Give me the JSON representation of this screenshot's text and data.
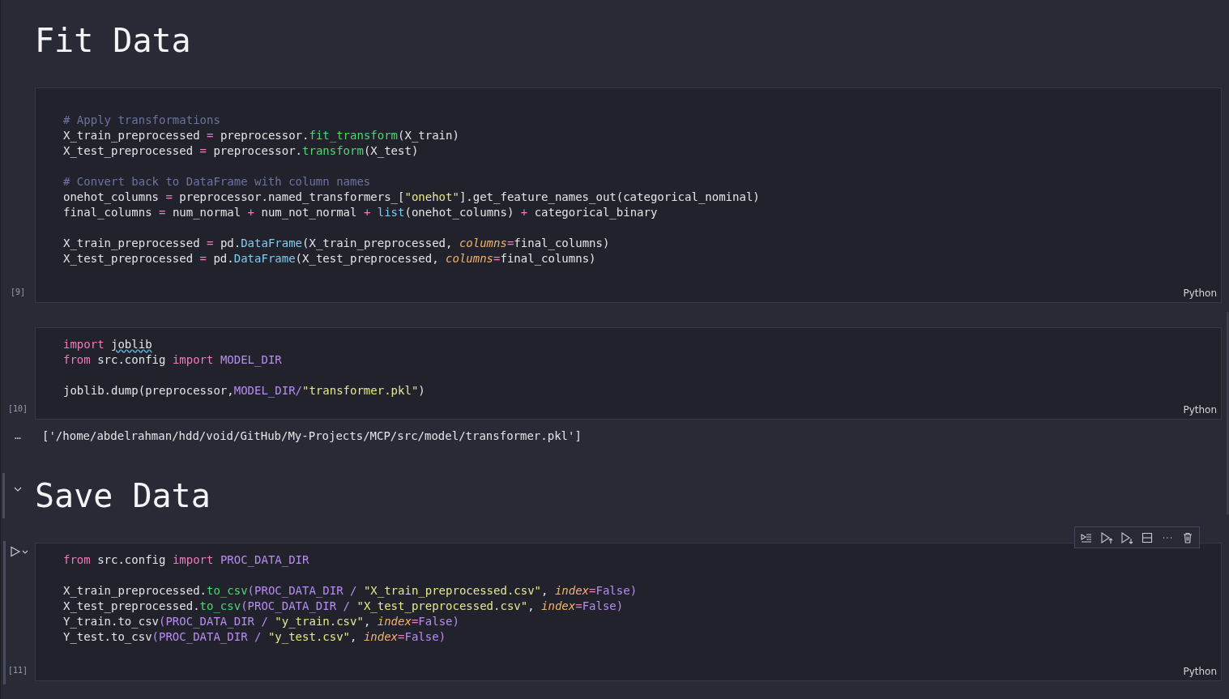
{
  "cells": [
    {
      "kind": "markdown",
      "text": "Fit Data",
      "selected": false
    },
    {
      "kind": "code",
      "count": "[9]",
      "language": "Python",
      "focused": false,
      "lines": [
        {
          "kind": "blank"
        },
        {
          "kind": "code",
          "tokens": [
            {
              "kind": "comment",
              "s": "# Apply transformations"
            }
          ]
        },
        {
          "kind": "code",
          "tokens": [
            {
              "kind": "plain",
              "s": "X_train_preprocessed "
            },
            {
              "kind": "op",
              "s": "="
            },
            {
              "kind": "plain",
              "s": " preprocessor."
            },
            {
              "kind": "func",
              "s": "fit_transform"
            },
            {
              "kind": "plain",
              "s": "(X_train)"
            }
          ]
        },
        {
          "kind": "code",
          "tokens": [
            {
              "kind": "plain",
              "s": "X_test_preprocessed "
            },
            {
              "kind": "op",
              "s": "="
            },
            {
              "kind": "plain",
              "s": " preprocessor."
            },
            {
              "kind": "func",
              "s": "transform"
            },
            {
              "kind": "plain",
              "s": "(X_test)"
            }
          ]
        },
        {
          "kind": "blank"
        },
        {
          "kind": "code",
          "tokens": [
            {
              "kind": "comment",
              "s": "# Convert back to DataFrame with column names"
            }
          ]
        },
        {
          "kind": "code",
          "tokens": [
            {
              "kind": "plain",
              "s": "onehot_columns "
            },
            {
              "kind": "op",
              "s": "="
            },
            {
              "kind": "plain",
              "s": " preprocessor.named_transformers_["
            },
            {
              "kind": "string",
              "s": "\"onehot\""
            },
            {
              "kind": "plain",
              "s": "].get_feature_names_out(categorical_nominal)"
            }
          ]
        },
        {
          "kind": "code",
          "tokens": [
            {
              "kind": "plain",
              "s": "final_columns "
            },
            {
              "kind": "op",
              "s": "="
            },
            {
              "kind": "plain",
              "s": " num_normal "
            },
            {
              "kind": "op",
              "s": "+"
            },
            {
              "kind": "plain",
              "s": " num_not_normal "
            },
            {
              "kind": "op",
              "s": "+ "
            },
            {
              "kind": "builtin",
              "s": "list"
            },
            {
              "kind": "plain",
              "s": "(onehot_columns) "
            },
            {
              "kind": "op",
              "s": "+"
            },
            {
              "kind": "plain",
              "s": " categorical_binary"
            }
          ]
        },
        {
          "kind": "blank"
        },
        {
          "kind": "code",
          "tokens": [
            {
              "kind": "plain",
              "s": "X_train_preprocessed "
            },
            {
              "kind": "op",
              "s": "="
            },
            {
              "kind": "plain",
              "s": " pd."
            },
            {
              "kind": "builtin",
              "s": "DataFrame"
            },
            {
              "kind": "plain",
              "s": "(X_train_preprocessed, "
            },
            {
              "kind": "param",
              "s": "columns"
            },
            {
              "kind": "op",
              "s": "="
            },
            {
              "kind": "plain",
              "s": "final_columns)"
            }
          ]
        },
        {
          "kind": "code",
          "tokens": [
            {
              "kind": "plain",
              "s": "X_test_preprocessed "
            },
            {
              "kind": "op",
              "s": "="
            },
            {
              "kind": "plain",
              "s": " pd."
            },
            {
              "kind": "builtin",
              "s": "DataFrame"
            },
            {
              "kind": "plain",
              "s": "(X_test_preprocessed, "
            },
            {
              "kind": "param",
              "s": "columns"
            },
            {
              "kind": "op",
              "s": "="
            },
            {
              "kind": "plain",
              "s": "final_columns)"
            }
          ]
        },
        {
          "kind": "blank"
        }
      ]
    },
    {
      "kind": "code",
      "count": "[10]",
      "language": "Python",
      "focused": false,
      "lines": [
        {
          "kind": "code",
          "tokens": [
            {
              "kind": "keyword",
              "s": "import "
            },
            {
              "kind": "squiggle",
              "s": "joblib"
            }
          ]
        },
        {
          "kind": "code",
          "tokens": [
            {
              "kind": "keyword",
              "s": "from"
            },
            {
              "kind": "plain",
              "s": " src.config "
            },
            {
              "kind": "keyword",
              "s": "import "
            },
            {
              "kind": "const",
              "s": "MODEL_DIR"
            }
          ]
        },
        {
          "kind": "blank"
        },
        {
          "kind": "code",
          "tokens": [
            {
              "kind": "plain",
              "s": "joblib.dump(preprocessor,"
            },
            {
              "kind": "const",
              "s": "MODEL_DIR/"
            },
            {
              "kind": "string",
              "s": "\"transformer.pkl\""
            },
            {
              "kind": "plain",
              "s": ")"
            }
          ]
        }
      ]
    },
    {
      "kind": "output",
      "marker": "…",
      "text": "['/home/abdelrahman/hdd/void/GitHub/My-Projects/MCP/src/model/transformer.pkl']"
    },
    {
      "kind": "markdown",
      "text": "Save Data",
      "selected": true
    },
    {
      "kind": "code",
      "count": "[11]",
      "language": "Python",
      "focused": true,
      "lines": [
        {
          "kind": "code",
          "tokens": [
            {
              "kind": "keyword",
              "s": "from"
            },
            {
              "kind": "plain",
              "s": " src.config "
            },
            {
              "kind": "keyword",
              "s": "import "
            },
            {
              "kind": "const",
              "s": "PROC_DATA_DIR"
            }
          ]
        },
        {
          "kind": "blank"
        },
        {
          "kind": "code",
          "tokens": [
            {
              "kind": "plain",
              "s": "X_train_preprocessed."
            },
            {
              "kind": "func",
              "s": "to_csv"
            },
            {
              "kind": "const",
              "s": "(PROC_DATA_DIR / "
            },
            {
              "kind": "string",
              "s": "\"X_train_preprocessed.csv\""
            },
            {
              "kind": "plain",
              "s": ", "
            },
            {
              "kind": "param",
              "s": "index"
            },
            {
              "kind": "op",
              "s": "="
            },
            {
              "kind": "const",
              "s": "False)"
            }
          ]
        },
        {
          "kind": "code",
          "tokens": [
            {
              "kind": "plain",
              "s": "X_test_preprocessed."
            },
            {
              "kind": "func",
              "s": "to_csv"
            },
            {
              "kind": "const",
              "s": "(PROC_DATA_DIR / "
            },
            {
              "kind": "string",
              "s": "\"X_test_preprocessed.csv\""
            },
            {
              "kind": "plain",
              "s": ", "
            },
            {
              "kind": "param",
              "s": "index"
            },
            {
              "kind": "op",
              "s": "="
            },
            {
              "kind": "const",
              "s": "False)"
            }
          ]
        },
        {
          "kind": "code",
          "tokens": [
            {
              "kind": "plain",
              "s": "Y_train.to_csv"
            },
            {
              "kind": "const",
              "s": "(PROC_DATA_DIR / "
            },
            {
              "kind": "string",
              "s": "\"y_train.csv\""
            },
            {
              "kind": "plain",
              "s": ", "
            },
            {
              "kind": "param",
              "s": "index"
            },
            {
              "kind": "op",
              "s": "="
            },
            {
              "kind": "const",
              "s": "False)"
            }
          ]
        },
        {
          "kind": "code",
          "tokens": [
            {
              "kind": "plain",
              "s": "Y_test.to_csv"
            },
            {
              "kind": "const",
              "s": "(PROC_DATA_DIR / "
            },
            {
              "kind": "string",
              "s": "\"y_test.csv\""
            },
            {
              "kind": "plain",
              "s": ", "
            },
            {
              "kind": "param",
              "s": "index"
            },
            {
              "kind": "op",
              "s": "="
            },
            {
              "kind": "const",
              "s": "False)"
            }
          ]
        },
        {
          "kind": "blank"
        }
      ]
    }
  ]
}
